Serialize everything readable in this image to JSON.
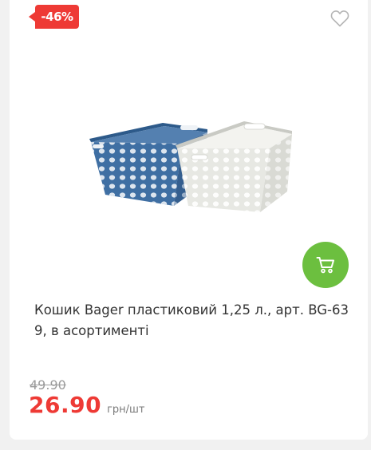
{
  "product": {
    "discount_badge": "-46%",
    "title": "Кошик Bager пластиковий 1,25 л., арт. BG-63 9, в асортименті",
    "old_price": "49.90",
    "price": "26.90",
    "unit": "грн/шт",
    "image_icon": "plastic-baskets-image"
  },
  "icons": {
    "favorite": "heart-outline-icon",
    "cart": "shopping-cart-icon"
  },
  "colors": {
    "badge": "#ee3a35",
    "price": "#ee3a35",
    "cart_button": "#6cbf3f",
    "old_price": "#9a9a9a",
    "basket_blue": "#3f6fa3",
    "basket_white": "#e7e8e3"
  }
}
